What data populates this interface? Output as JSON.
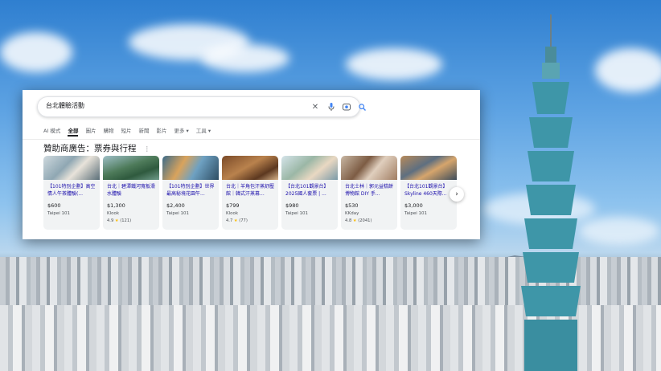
{
  "search": {
    "query": "台北體驗活動"
  },
  "icons": {
    "clear": "close-icon",
    "voice": "mic-icon",
    "lens": "camera-lens-icon",
    "search": "search-icon"
  },
  "tabs": [
    {
      "label": "AI 模式"
    },
    {
      "label": "全部",
      "active": true
    },
    {
      "label": "圖片"
    },
    {
      "label": "購物"
    },
    {
      "label": "短片"
    },
    {
      "label": "新聞"
    },
    {
      "label": "影片"
    },
    {
      "label": "更多 ▾"
    },
    {
      "label": "工具 ▾"
    }
  ],
  "sponsored": {
    "heading": "贊助商廣告：票券與行程",
    "more_label": "⋮"
  },
  "cards": [
    {
      "title": "【101特別企劃】高空情人午茶體驗(...",
      "price": "$600",
      "seller": "Taipei 101",
      "rating": ""
    },
    {
      "title": "台北｜碧潭鐵河寬板滑水體驗",
      "price": "$1,300",
      "seller": "Klook",
      "rating": "4.9 ★ (121)"
    },
    {
      "title": "【101特別企劃】世界最高秘境花園午...",
      "price": "$2,400",
      "seller": "Taipei 101",
      "rating": ""
    },
    {
      "title": "台北｜羊角包汗蒸舒壓館｜韓式汗蒸幕...",
      "price": "$799",
      "seller": "Klook",
      "rating": "4.7 ★ (77)"
    },
    {
      "title": "【台北101觀景台】2025國人套票 | ...",
      "price": "$980",
      "seller": "Taipei 101",
      "rating": ""
    },
    {
      "title": "台北士林｜郭元益糕餅博物館 DIY 手...",
      "price": "$530",
      "seller": "KKday",
      "rating": "4.8 ★ (2041)"
    },
    {
      "title": "【台北101觀景台】Skyline 460天際...",
      "price": "$3,000",
      "seller": "Taipei 101",
      "rating": ""
    }
  ],
  "colors": {
    "link": "#1a0dab",
    "star": "#fbbc04",
    "card_bg": "#f1f3f4"
  }
}
